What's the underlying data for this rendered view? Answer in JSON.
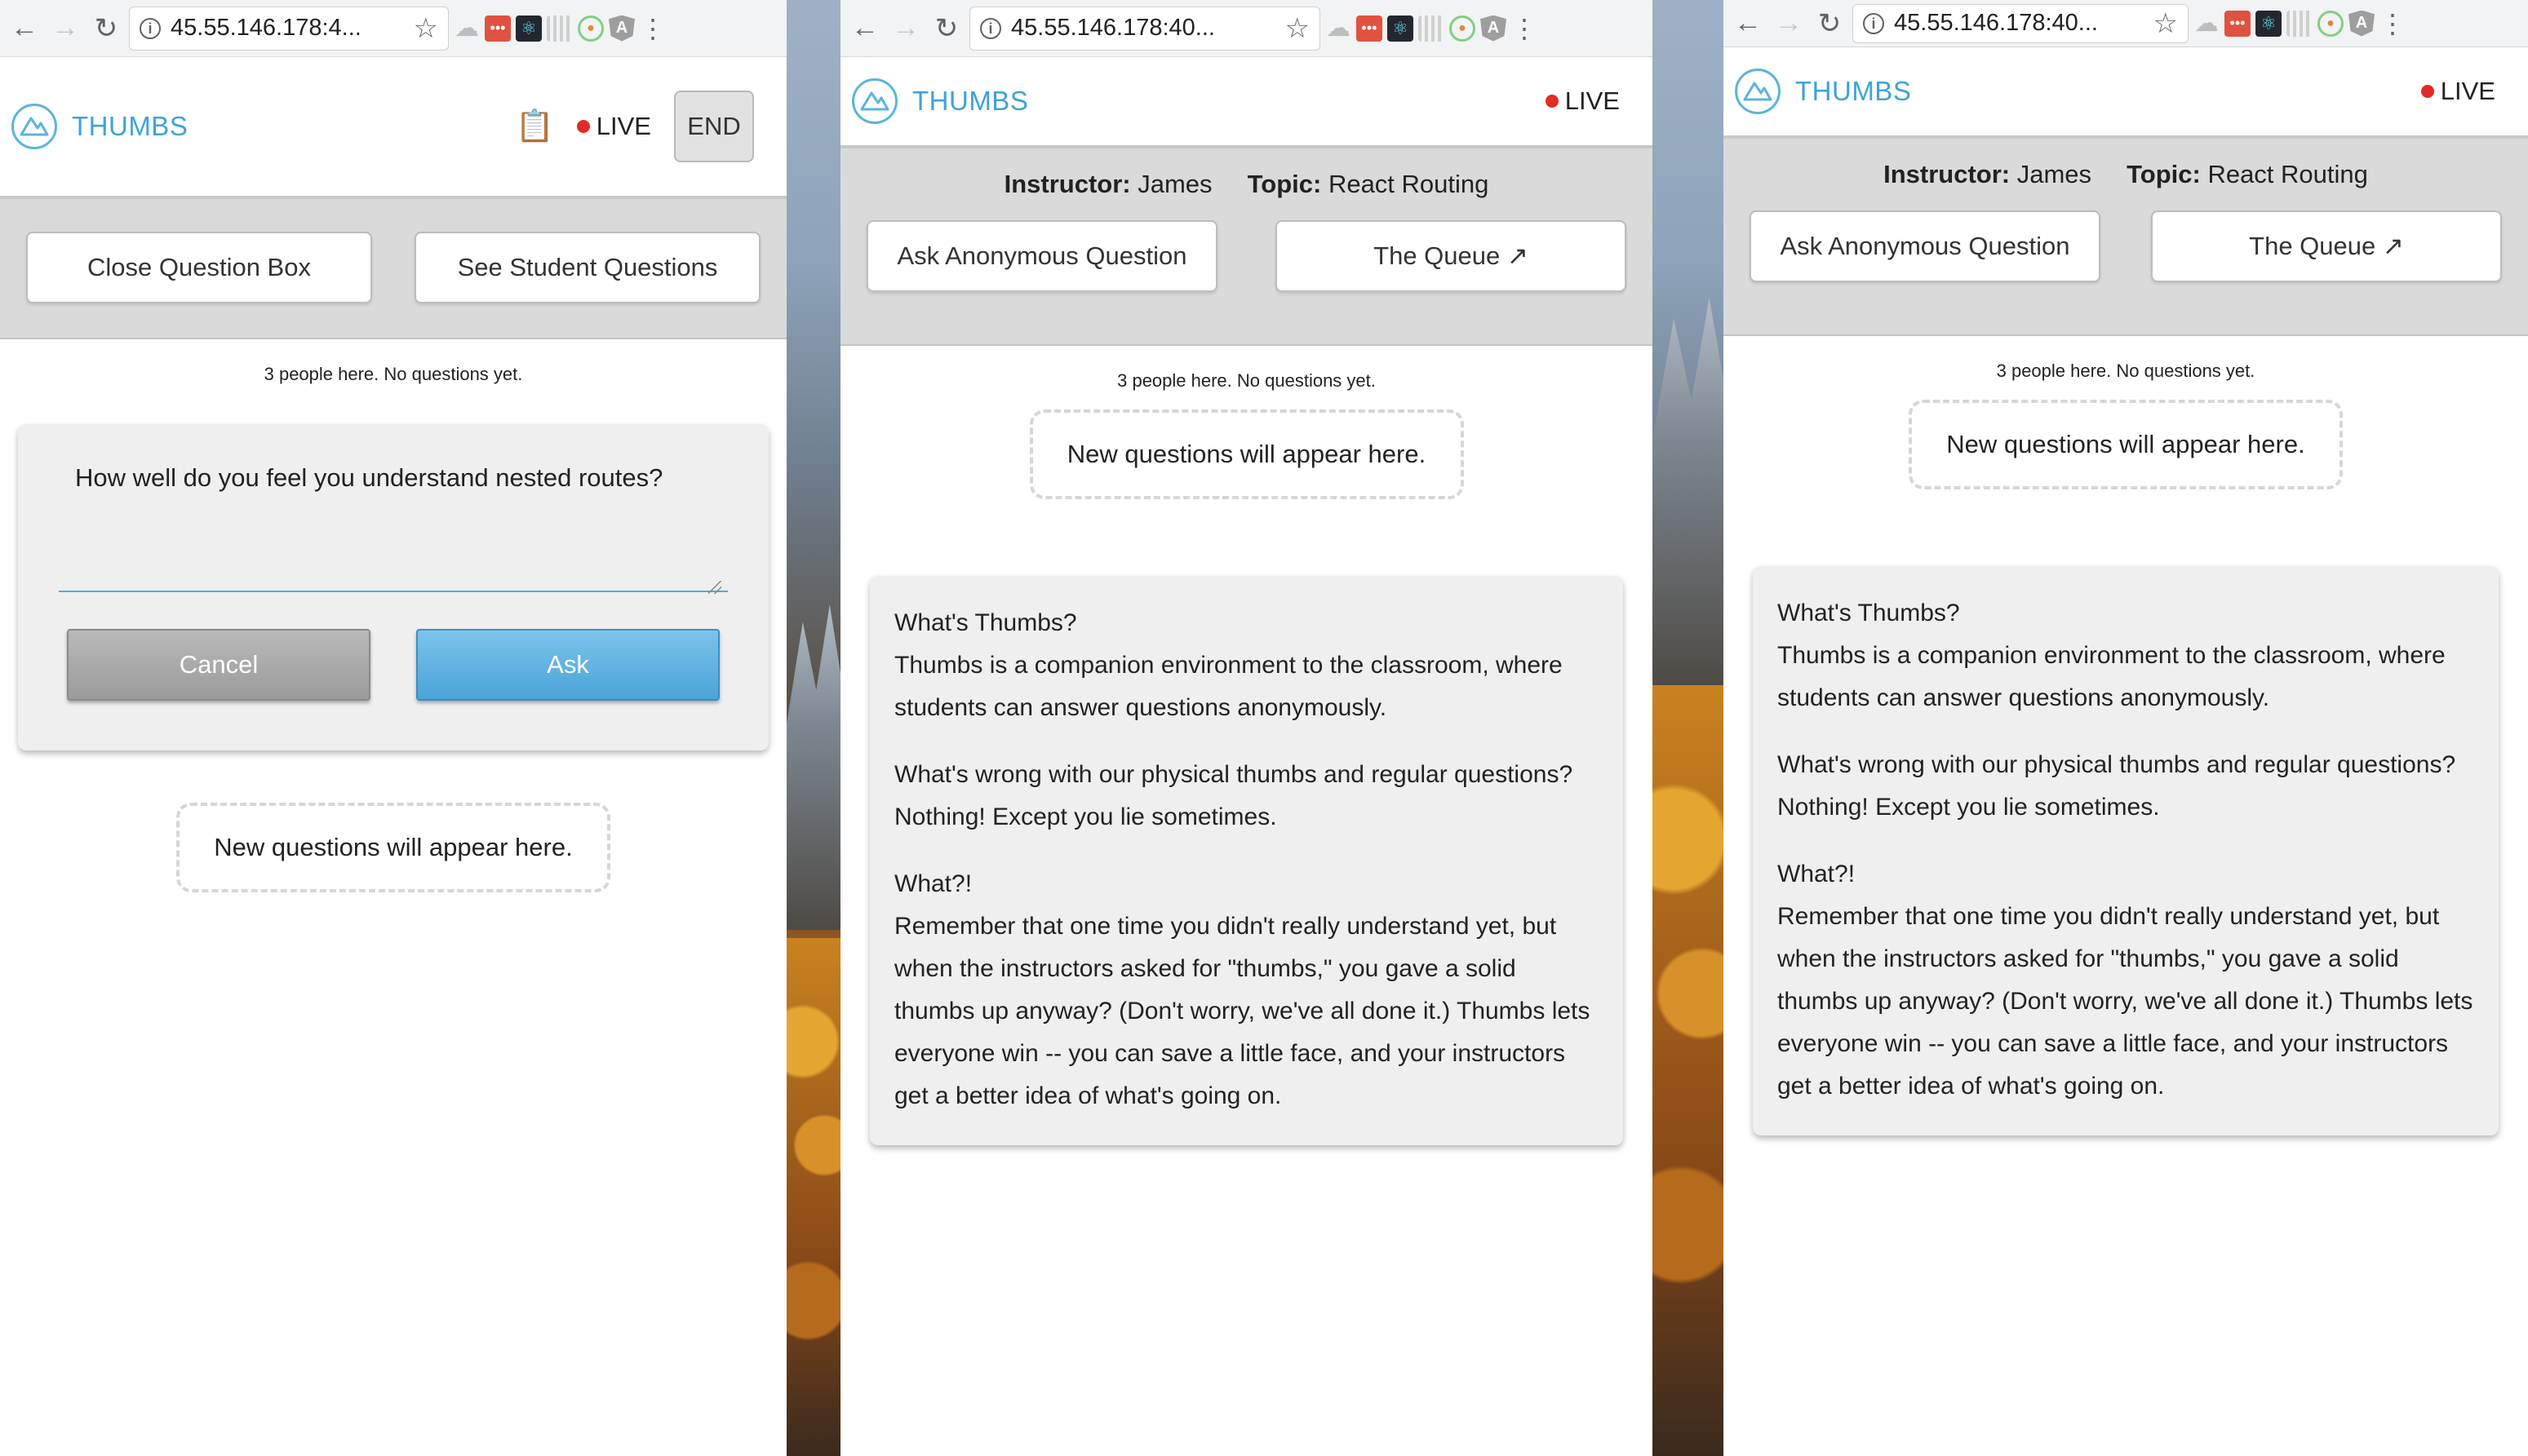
{
  "browser": {
    "url": "45.55.146.178:4...",
    "url_w2": "45.55.146.178:40...",
    "url_w3": "45.55.146.178:40..."
  },
  "app": {
    "name": "THUMBS",
    "live_label": "LIVE",
    "end_label": "END",
    "accent_color": "#3ea3d6",
    "live_color": "#e42a26"
  },
  "instructor_view": {
    "close_button": "Close Question Box",
    "see_questions_button": "See Student Questions",
    "status": "3 people here. No questions yet.",
    "question_text": "How well do you feel you understand nested routes?",
    "cancel_button": "Cancel",
    "ask_button": "Ask",
    "placeholder": "New questions will appear here."
  },
  "student_view": {
    "instructor_label": "Instructor:",
    "instructor_name": "James",
    "topic_label": "Topic:",
    "topic_name": "React Routing",
    "ask_anon_button": "Ask Anonymous Question",
    "queue_button": "The Queue ↗",
    "status": "3 people here. No questions yet.",
    "placeholder": "New questions will appear here.",
    "faq": [
      {
        "q": "What's Thumbs?",
        "a": "Thumbs is a companion environment to the classroom, where students can answer questions anonymously."
      },
      {
        "q": "What's wrong with our physical thumbs and regular questions?",
        "a": "Nothing! Except you lie sometimes."
      },
      {
        "q": "What?!",
        "a": "Remember that one time you didn't really understand yet, but when the instructors asked for \"thumbs,\" you gave a solid thumbs up anyway? (Don't worry, we've all done it.) Thumbs lets everyone win -- you can save a little face, and your instructors get a better idea of what's going on."
      }
    ]
  }
}
